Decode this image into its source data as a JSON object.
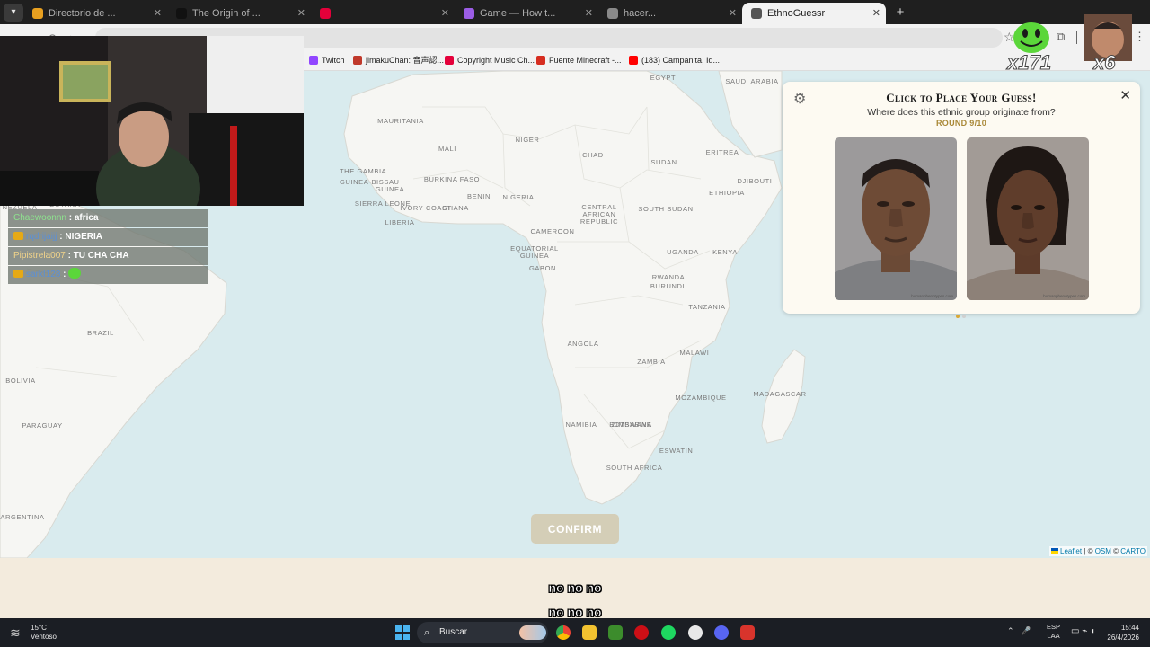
{
  "browser": {
    "tabs": [
      {
        "title": "Directorio de ...",
        "favicon_color": "#e8a020"
      },
      {
        "title": "The Origin of ...",
        "favicon_color": "#111111"
      },
      {
        "title": "",
        "favicon_color": "#e4003a"
      },
      {
        "title": "Game — How t...",
        "favicon_color": "#9b5de5"
      },
      {
        "title": "hacer...",
        "favicon_color": "#8a8a8a"
      },
      {
        "title": "EthnoGuessr",
        "favicon_color": "#555555",
        "active": true
      }
    ],
    "new_tab_icon": "plus-icon",
    "bookmarks": [
      {
        "label": "Twitch",
        "color": "#9146ff"
      },
      {
        "label": "jimakuChan: 音声認...",
        "color": "#c0392b"
      },
      {
        "label": "Copyright Music Ch...",
        "color": "#e4003a"
      },
      {
        "label": "Fuente Minecraft -...",
        "color": "#d62d20"
      },
      {
        "label": "(183) Campanita, Id...",
        "color": "#ff0000"
      }
    ]
  },
  "stream": {
    "chat": [
      {
        "user": "Chaewoonnn",
        "message": "africa",
        "user_color": "#8ee28e",
        "badge": false
      },
      {
        "user": "rqdrijaijj",
        "message": "NIGERIA",
        "user_color": "#5b8fd6",
        "badge": true
      },
      {
        "user": "Pipistrela007",
        "message": "TU CHA CHA",
        "user_color": "#f2d48a",
        "badge": false
      },
      {
        "user": "sarkI128",
        "message": "",
        "user_color": "#5b8fd6",
        "badge": true
      }
    ],
    "emote_counts": [
      "x171",
      "x6"
    ],
    "subtitles": [
      "no no no",
      "no no no"
    ]
  },
  "map": {
    "labels": [
      {
        "text": "EGYPT"
      },
      {
        "text": "SAUDI ARABIA"
      },
      {
        "text": "MAURITANIA"
      },
      {
        "text": "MALI"
      },
      {
        "text": "NIGER"
      },
      {
        "text": "CHAD"
      },
      {
        "text": "SUDAN"
      },
      {
        "text": "ERITREA"
      },
      {
        "text": "THE GAMBIA"
      },
      {
        "text": "GUINEA-BISSAU"
      },
      {
        "text": "BURKINA FASO"
      },
      {
        "text": "GUINEA"
      },
      {
        "text": "BENIN"
      },
      {
        "text": "NIGERIA"
      },
      {
        "text": "DJIBOUTI"
      },
      {
        "text": "ETHIOPIA"
      },
      {
        "text": "SIERRA LEONE"
      },
      {
        "text": "IVORY COAST"
      },
      {
        "text": "GHANA"
      },
      {
        "text": "CENTRAL AFRICAN REPUBLIC"
      },
      {
        "text": "SOUTH SUDAN"
      },
      {
        "text": "LIBERIA"
      },
      {
        "text": "CAMEROON"
      },
      {
        "text": "UGANDA"
      },
      {
        "text": "KENYA"
      },
      {
        "text": "EQUATORIAL GUINEA"
      },
      {
        "text": "GABON"
      },
      {
        "text": "RWANDA"
      },
      {
        "text": "BURUNDI"
      },
      {
        "text": "TANZANIA"
      },
      {
        "text": "ANGOLA"
      },
      {
        "text": "MALAWI"
      },
      {
        "text": "ZAMBIA"
      },
      {
        "text": "MOZAMBIQUE"
      },
      {
        "text": "MADAGASCAR"
      },
      {
        "text": "NAMIBIA"
      },
      {
        "text": "BOTSWANA"
      },
      {
        "text": "ZIMBABWE"
      },
      {
        "text": "ESWATINI"
      },
      {
        "text": "SOUTH AFRICA"
      },
      {
        "text": "BRAZIL"
      },
      {
        "text": "BOLIVIA"
      },
      {
        "text": "PARAGUAY"
      },
      {
        "text": "ARGENTINA"
      },
      {
        "text": "GUYANA"
      },
      {
        "text": "NEZUELA"
      }
    ],
    "confirm_label": "CONFIRM",
    "attribution": {
      "leaflet": "Leaflet",
      "osm": "OSM",
      "carto": "CARTO",
      "sep": " | © ",
      "sep2": " © "
    }
  },
  "panel": {
    "title": "Click to Place Your Guess!",
    "subtitle": "Where does this ethnic group originate from?",
    "round": "ROUND 9/10",
    "watermark": "humanphenotypes.com",
    "settings_icon": "gear-icon",
    "close_icon": "close-icon",
    "dot_active_color": "#d9a736",
    "dot_inactive_color": "#cfcfcf"
  },
  "taskbar": {
    "temperature": "15°C",
    "weather": "Ventoso",
    "search_placeholder": "Buscar",
    "language_line1": "ESP",
    "language_line2": "LAA",
    "time": "15:44",
    "date": "26/4/2026"
  }
}
